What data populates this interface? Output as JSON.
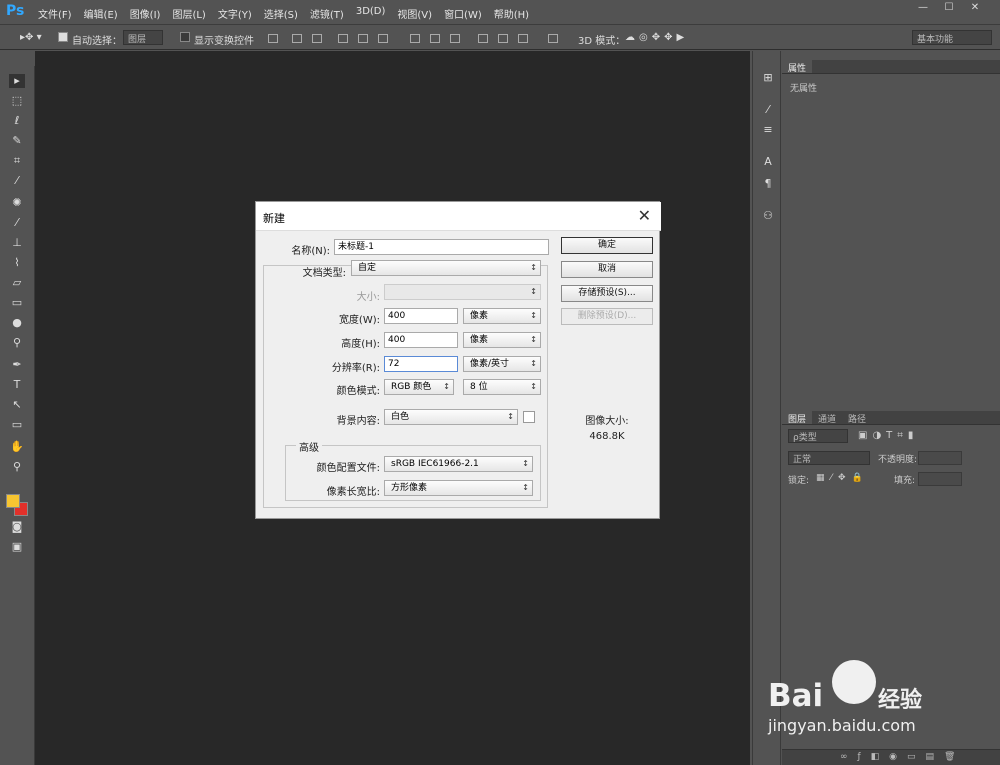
{
  "app": {
    "logo": "Ps",
    "menus": [
      "文件(F)",
      "编辑(E)",
      "图像(I)",
      "图层(L)",
      "文字(Y)",
      "选择(S)",
      "滤镜(T)",
      "3D(D)",
      "视图(V)",
      "窗口(W)",
      "帮助(H)"
    ],
    "win_min": "—",
    "win_max": "☐",
    "win_close": "✕"
  },
  "options": {
    "auto_select_label": "自动选择：",
    "auto_select_value": "图层",
    "show_transform": "显示变换控件",
    "mode3d": "3D 模式：",
    "workspace": "基本功能"
  },
  "properties": {
    "tab": "属性",
    "empty": "无属性"
  },
  "layers": {
    "tabs": [
      "图层",
      "通道",
      "路径"
    ],
    "kind": "ρ类型",
    "blend": "正常",
    "opacity_label": "不透明度:",
    "lock_label": "锁定:",
    "fill_label": "填充:"
  },
  "dialog": {
    "title": "新建",
    "close": "✕",
    "name_label": "名称(N):",
    "name_value": "未标题-1",
    "doctype_label": "文档类型:",
    "doctype_value": "自定",
    "size_label": "大小:",
    "width_label": "宽度(W):",
    "width_value": "400",
    "width_unit": "像素",
    "height_label": "高度(H):",
    "height_value": "400",
    "height_unit": "像素",
    "res_label": "分辨率(R):",
    "res_value": "72",
    "res_unit": "像素/英寸",
    "color_label": "颜色模式:",
    "color_value": "RGB 颜色",
    "bit_value": "8 位",
    "bg_label": "背景内容:",
    "bg_value": "白色",
    "advanced_label": "高级",
    "profile_label": "颜色配置文件:",
    "profile_value": "sRGB IEC61966-2.1",
    "pixel_ratio_label": "像素长宽比:",
    "pixel_ratio_value": "方形像素",
    "ok": "确定",
    "cancel": "取消",
    "save_preset": "存储预设(S)...",
    "delete_preset": "删除预设(D)...",
    "image_size_label": "图像大小:",
    "image_size_value": "468.8K"
  },
  "watermark": {
    "brand": "Bai",
    "brand2": "经验",
    "url": "jingyan.baidu.com"
  },
  "colors": {
    "foreground": "#f7c531",
    "background": "#e2302a",
    "ps_blue": "#31a8ff"
  }
}
